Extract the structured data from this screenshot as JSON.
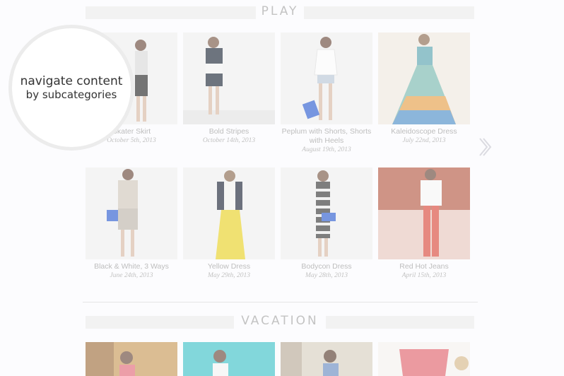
{
  "sections": [
    {
      "title": "PLAY"
    },
    {
      "title": "VACATION"
    }
  ],
  "play_items": [
    {
      "name": "Skater Skirt",
      "date": "October 5th, 2013"
    },
    {
      "name": "Bold Stripes",
      "date": "October 14th, 2013"
    },
    {
      "name": "Peplum with Shorts, Shorts with Heels",
      "date": "August 19th, 2013"
    },
    {
      "name": "Kaleidoscope Dress",
      "date": "July 22nd, 2013"
    },
    {
      "name": "Black & White, 3 Ways",
      "date": "June 24th, 2013"
    },
    {
      "name": "Yellow Dress",
      "date": "May 29th, 2013"
    },
    {
      "name": "Bodycon Dress",
      "date": "May 28th, 2013"
    },
    {
      "name": "Red Hot Jeans",
      "date": "April 15th, 2013"
    }
  ],
  "callout": {
    "line1": "navigate content",
    "line2": "by subcategories"
  },
  "icons": {
    "next": "chevron-right-icon"
  },
  "colors": {
    "background": "#fbfbfd",
    "header_bar": "#ececec",
    "text": "#9a9a9a"
  }
}
